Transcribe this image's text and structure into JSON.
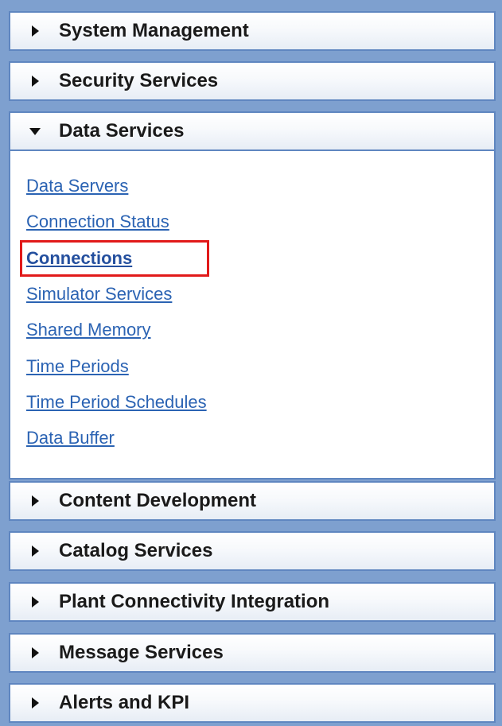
{
  "panel": {
    "sections": [
      {
        "title": "System Management",
        "state": "collapsed",
        "arrow_icon": "caret-right-icon"
      },
      {
        "title": "Security Services",
        "state": "collapsed",
        "arrow_icon": "caret-right-icon"
      },
      {
        "title": "Data Services",
        "state": "expanded",
        "arrow_icon": "caret-down-icon",
        "links": [
          "Data Servers",
          "Connection Status",
          "Connections",
          "Simulator Services",
          "Shared Memory",
          "Time Periods",
          "Time Period Schedules",
          "Data Buffer"
        ],
        "selected_link": "Connections"
      },
      {
        "title": "Content Development",
        "state": "collapsed",
        "arrow_icon": "caret-right-icon"
      },
      {
        "title": "Catalog Services",
        "state": "collapsed",
        "arrow_icon": "caret-right-icon"
      },
      {
        "title": "Plant Connectivity Integration",
        "state": "collapsed",
        "arrow_icon": "caret-right-icon"
      },
      {
        "title": "Message Services",
        "state": "collapsed",
        "arrow_icon": "caret-right-icon"
      },
      {
        "title": "Alerts and KPI",
        "state": "collapsed",
        "arrow_icon": "caret-right-icon"
      }
    ]
  },
  "colors": {
    "panel_background": "#7ea0cf",
    "header_border": "#5f86c0",
    "link": "#2b63b3",
    "highlight_box": "#e11a1a"
  }
}
